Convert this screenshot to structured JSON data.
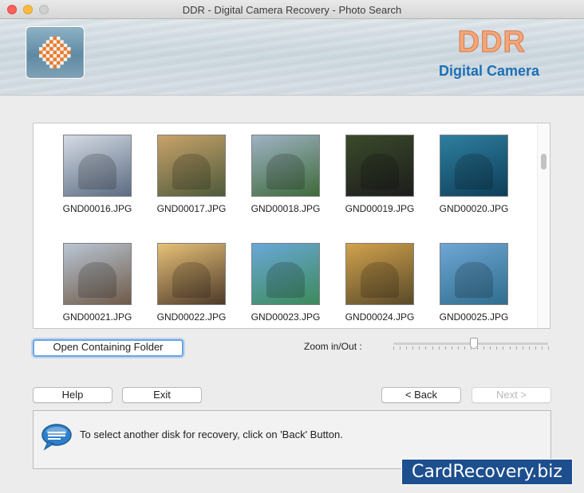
{
  "window": {
    "title": "DDR - Digital Camera Recovery - Photo Search"
  },
  "banner": {
    "brand": "DDR",
    "product": "Digital Camera"
  },
  "gallery": {
    "files": [
      {
        "name": "GND00016.JPG",
        "c1": "#d4dbe4",
        "c2": "#5b6b82"
      },
      {
        "name": "GND00017.JPG",
        "c1": "#c9a36a",
        "c2": "#4e5a3a"
      },
      {
        "name": "GND00018.JPG",
        "c1": "#9fb2c4",
        "c2": "#3e6a3a"
      },
      {
        "name": "GND00019.JPG",
        "c1": "#3a4a2a",
        "c2": "#1d1d1d"
      },
      {
        "name": "GND00020.JPG",
        "c1": "#2e7fa0",
        "c2": "#0e3e58"
      },
      {
        "name": "GND00021.JPG",
        "c1": "#b9c6d4",
        "c2": "#6f5a48"
      },
      {
        "name": "GND00022.JPG",
        "c1": "#e8c178",
        "c2": "#4d3a2a"
      },
      {
        "name": "GND00023.JPG",
        "c1": "#69a8d8",
        "c2": "#3c8a5a"
      },
      {
        "name": "GND00024.JPG",
        "c1": "#d1a24c",
        "c2": "#5a4a2a"
      },
      {
        "name": "GND00025.JPG",
        "c1": "#6fa6d4",
        "c2": "#2f6e8e"
      }
    ]
  },
  "controls": {
    "open_folder": "Open Containing Folder",
    "zoom_label": "Zoom in/Out :",
    "zoom_level": 0.52
  },
  "nav": {
    "help": "Help",
    "exit": "Exit",
    "back": "< Back",
    "next": "Next >"
  },
  "message": {
    "text": "To select another disk for recovery, click on 'Back' Button."
  },
  "watermark": {
    "text": "CardRecovery.biz"
  }
}
